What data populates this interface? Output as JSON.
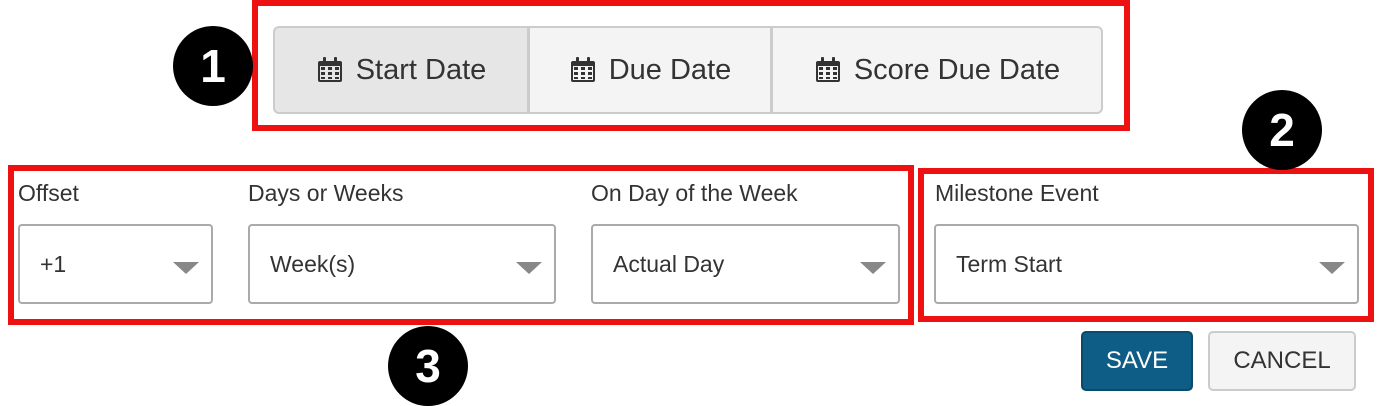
{
  "date_buttons": {
    "start_label": "Start Date",
    "due_label": "Due Date",
    "score_label": "Score Due Date",
    "active": "Start Date",
    "icon": "calendar-icon"
  },
  "fields": {
    "offset": {
      "label": "Offset",
      "value": "+1"
    },
    "days_or_weeks": {
      "label": "Days or Weeks",
      "value": "Week(s)"
    },
    "on_day_of_week": {
      "label": "On Day of the Week",
      "value": "Actual Day"
    },
    "milestone_event": {
      "label": "Milestone Event",
      "value": "Term Start"
    }
  },
  "actions": {
    "save_label": "SAVE",
    "cancel_label": "CANCEL"
  },
  "callouts": {
    "one": "1",
    "two": "2",
    "three": "3"
  },
  "colors": {
    "highlight": "#ee1111",
    "save_bg": "#0d5d86",
    "callout_bg": "#000000"
  }
}
